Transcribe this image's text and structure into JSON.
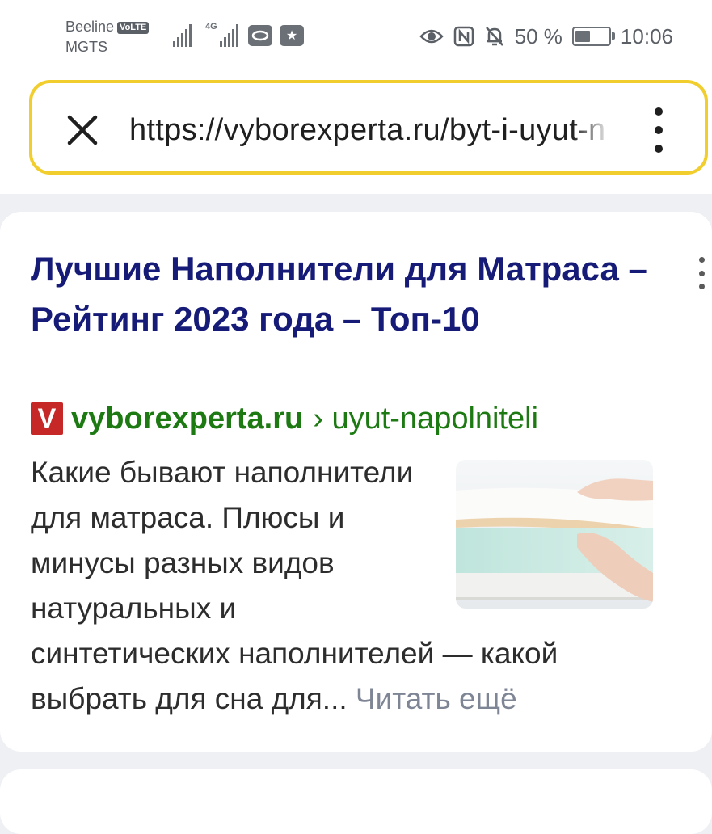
{
  "status_bar": {
    "carrier_primary": "Beeline",
    "volte_badge": "VoLTE",
    "carrier_secondary": "MGTS",
    "network_label": "4G",
    "battery_percent": "50 %",
    "time": "10:06",
    "icons": [
      "signal-strength-icon",
      "signal-4g-icon",
      "ring-notification-icon",
      "star-box-icon",
      "eye-icon",
      "nfc-icon",
      "bell-muted-icon",
      "battery-saver-icon"
    ]
  },
  "address_bar": {
    "url": "https://vyborexperta.ru/byt-i-uyut-napolniteli",
    "accent_color": "#f1cd2d"
  },
  "result": {
    "title": "Лучшие Наполнители для Матраса – Рейтинг 2023 года – Топ-10",
    "favicon_letter": "V",
    "domain": "vyborexperta.ru",
    "path": "› uyut-napolniteli",
    "snippet": "Какие бывают наполнители для матраса. Плюсы и минусы разных видов натуральных и синтетических наполнителей — какой выбрать для сна для...",
    "read_more": "Читать ещё",
    "colors": {
      "title": "#161b78",
      "url": "#1d7a13",
      "favicon": "#c62828",
      "read_more": "#7e8594"
    }
  }
}
